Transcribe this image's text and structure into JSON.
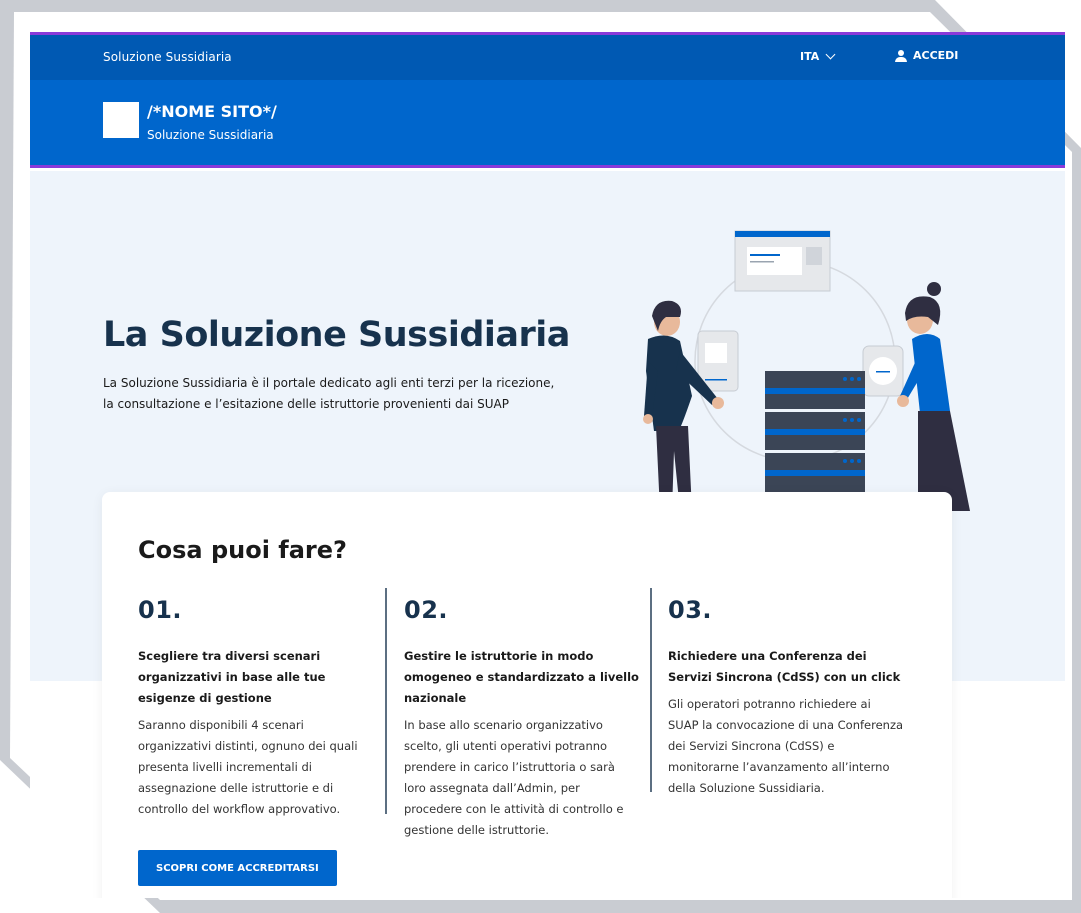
{
  "slim_header": {
    "brand": "Soluzione Sussidiaria",
    "language": "ITA",
    "login": "ACCEDI"
  },
  "center_header": {
    "site_name": "/*NOME SITO*/",
    "site_subtitle": "Soluzione Sussidiaria"
  },
  "hero": {
    "title": "La Soluzione Sussidiaria",
    "text": "La Soluzione Sussidiaria è il portale dedicato agli enti terzi per la ricezione, la consultazione e l’esitazione delle istruttorie provenienti dai SUAP"
  },
  "features": {
    "title": "Cosa puoi fare?",
    "items": [
      {
        "number": "01.",
        "heading": "Scegliere tra diversi scenari organizzativi in base alle tue esigenze di gestione",
        "body": "Saranno disponibili 4 scenari organizzativi distinti, ognuno dei quali presenta livelli incrementali di assegnazione delle istruttorie e di controllo del workflow approvativo."
      },
      {
        "number": "02.",
        "heading": "Gestire le istruttorie in modo omogeneo e standardizzato a livello nazionale",
        "body": "In base allo scenario organizzativo scelto, gli utenti operativi potranno prendere in carico l’istruttoria o sarà loro assegnata dall’Admin, per procedere con le attività di controllo e gestione delle istruttorie."
      },
      {
        "number": "03.",
        "heading": "Richiedere una Conferenza dei Servizi Sincrona (CdSS) con un click",
        "body": "Gli operatori potranno richiedere ai SUAP la convocazione di una Conferenza dei Servizi Sincrona (CdSS) e monitorarne l’avanzamento all’interno della Soluzione Sussidiaria."
      }
    ],
    "cta_label": "SCOPRI COME ACCREDITARSI"
  },
  "colors": {
    "primary": "#0066cc",
    "slim": "#0059b3",
    "accent": "#8a3ad9",
    "title": "#17324d",
    "hero_bg": "#eef4fb"
  },
  "icons": [
    "chevron-down-icon",
    "user-icon"
  ]
}
